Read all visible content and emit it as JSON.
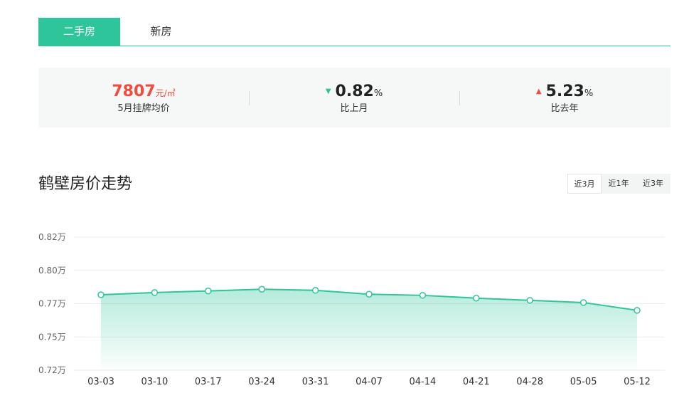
{
  "tabs": [
    {
      "label": "二手房",
      "active": true
    },
    {
      "label": "新房",
      "active": false
    }
  ],
  "stats": {
    "price": {
      "value": "7807",
      "unit": "元/㎡",
      "label": "5月挂牌均价"
    },
    "mom": {
      "direction": "down",
      "value": "0.82",
      "unit": "%",
      "label": "比上月"
    },
    "yoy": {
      "direction": "up",
      "value": "5.23",
      "unit": "%",
      "label": "比去年"
    }
  },
  "trend": {
    "title": "鹤壁房价走势",
    "ranges": [
      {
        "label": "近3月",
        "active": true
      },
      {
        "label": "近1年",
        "active": false
      },
      {
        "label": "近3年",
        "active": false
      }
    ]
  },
  "colors": {
    "accent": "#2fc59a",
    "up": "#f04c3d",
    "down": "#2fc59a"
  },
  "chart_data": {
    "type": "area",
    "categories": [
      "03-03",
      "03-10",
      "03-17",
      "03-24",
      "03-31",
      "04-07",
      "04-14",
      "04-21",
      "04-28",
      "05-05",
      "05-12"
    ],
    "values": [
      7780,
      7800,
      7815,
      7830,
      7820,
      7785,
      7775,
      7750,
      7730,
      7710,
      7660
    ],
    "ytick_values": [
      7200,
      7500,
      7700,
      8000,
      8200
    ],
    "ytick_labels": [
      "0.72万",
      "0.75万",
      "0.77万",
      "0.80万",
      "0.82万"
    ],
    "ylim": [
      7200,
      8200
    ],
    "title": "",
    "xlabel": "",
    "ylabel": ""
  }
}
